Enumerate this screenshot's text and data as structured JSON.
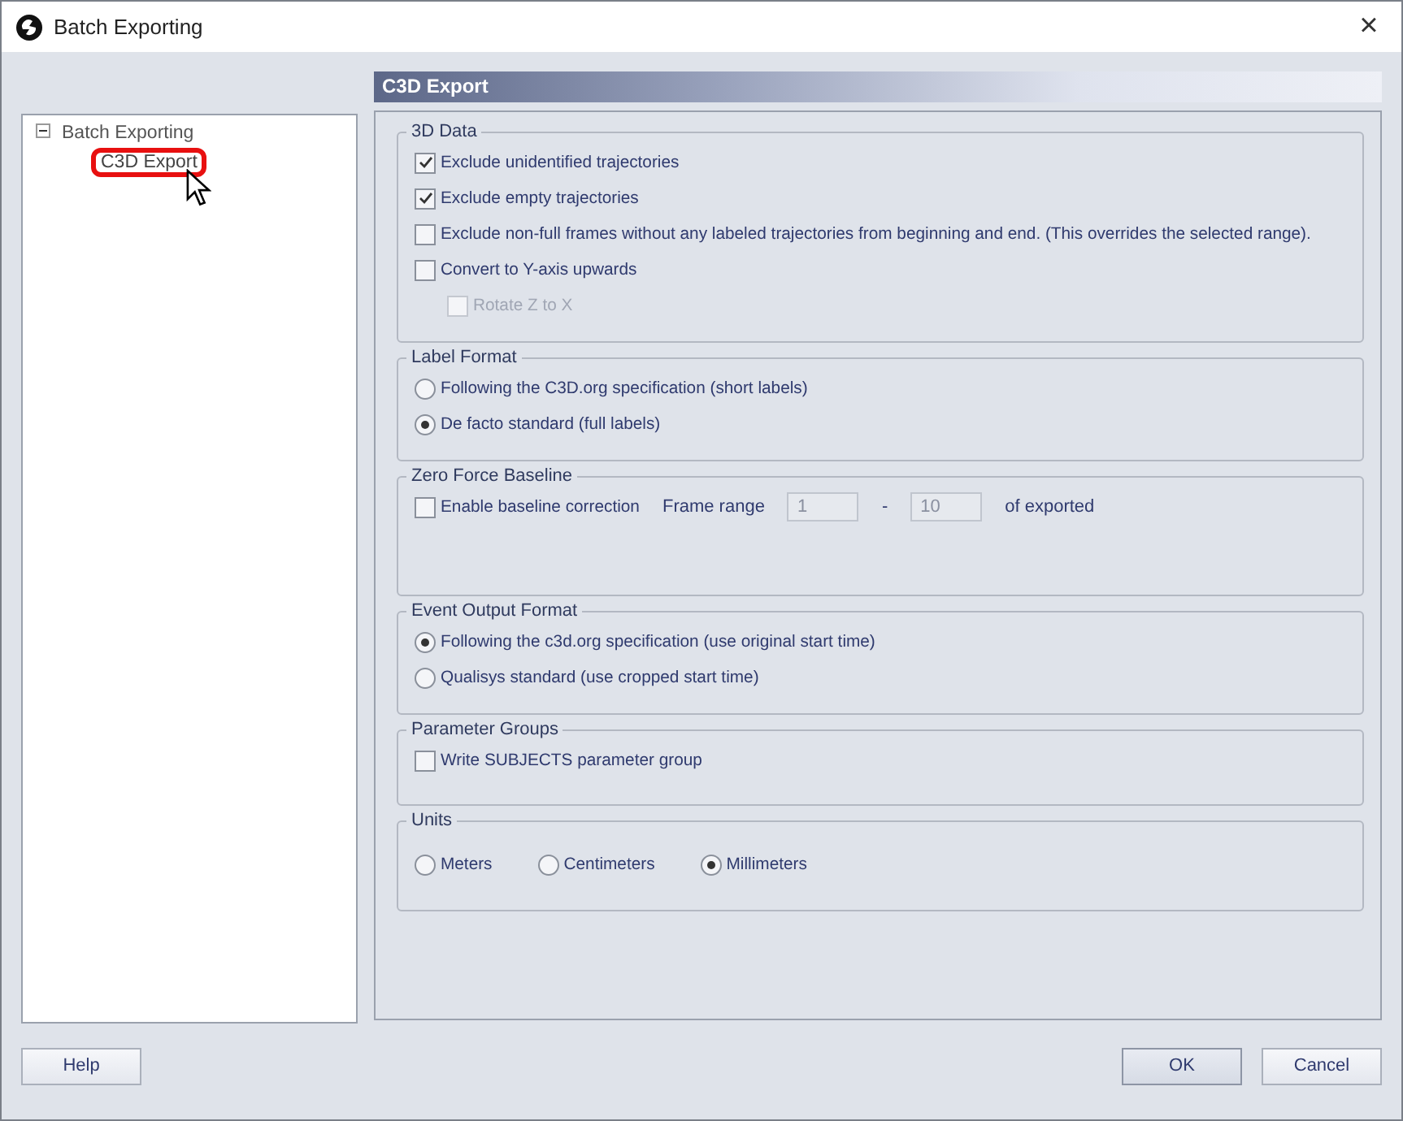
{
  "window": {
    "title": "Batch Exporting",
    "close": "×"
  },
  "tree": {
    "label": "Batch Exporting",
    "expanded": true,
    "children": [
      {
        "label": "C3D Export",
        "selected": true
      }
    ]
  },
  "panel_title": "C3D Export",
  "groups": [
    {
      "title": "3D Data",
      "rows": [
        [
          {
            "kind": "checkbox",
            "label": "Exclude unidentified trajectories",
            "checked": true,
            "disabled": false
          }
        ],
        [
          {
            "kind": "checkbox",
            "label": "Exclude empty trajectories",
            "checked": true,
            "disabled": false
          }
        ],
        [
          {
            "kind": "checkbox",
            "label": "Exclude non-full frames without any labeled trajectories from beginning and end. (This overrides the selected range).",
            "checked": false,
            "disabled": false
          }
        ],
        [
          {
            "kind": "checkbox",
            "label": "Convert to Y-axis upwards",
            "checked": false,
            "disabled": false,
            "children": [
              {
                "kind": "checkbox",
                "label": "Rotate Z to X",
                "checked": false,
                "disabled": true
              }
            ]
          }
        ]
      ]
    },
    {
      "title": "Label Format",
      "rows": [
        [
          {
            "kind": "radio",
            "label": "Following the C3D.org specification (short labels)",
            "selected": false
          }
        ],
        [
          {
            "kind": "radio",
            "label": "De facto standard (full labels)",
            "selected": true
          }
        ]
      ]
    },
    {
      "title": "Zero Force Baseline",
      "rows": [
        [
          {
            "kind": "checkbox",
            "label": "Enable baseline correction",
            "checked": false,
            "disabled": false
          },
          {
            "kind": "text",
            "label": "Frame range"
          },
          {
            "kind": "field",
            "value": "1",
            "disabled": true
          },
          {
            "kind": "text",
            "label": "-"
          },
          {
            "kind": "field",
            "value": "10",
            "disabled": true
          },
          {
            "kind": "text",
            "label": "of exported"
          }
        ]
      ]
    },
    {
      "title": "Event Output Format",
      "rows": [
        [
          {
            "kind": "radio",
            "label": "Following the c3d.org specification (use original start time)",
            "selected": true
          }
        ],
        [
          {
            "kind": "radio",
            "label": "Qualisys standard (use cropped start time)",
            "selected": false
          }
        ]
      ]
    },
    {
      "title": "Parameter Groups",
      "rows": [
        [
          {
            "kind": "checkbox",
            "label": "Write SUBJECTS parameter group",
            "checked": false,
            "disabled": false
          }
        ]
      ]
    },
    {
      "title": "Units",
      "rows": [
        [
          {
            "kind": "radio",
            "label": "Meters",
            "selected": false
          },
          {
            "kind": "radio",
            "label": "Centimeters",
            "selected": false
          },
          {
            "kind": "radio",
            "label": "Millimeters",
            "selected": true
          }
        ]
      ]
    }
  ],
  "buttons_left": [
    "Help"
  ],
  "buttons_right": [
    "OK",
    "Cancel"
  ]
}
